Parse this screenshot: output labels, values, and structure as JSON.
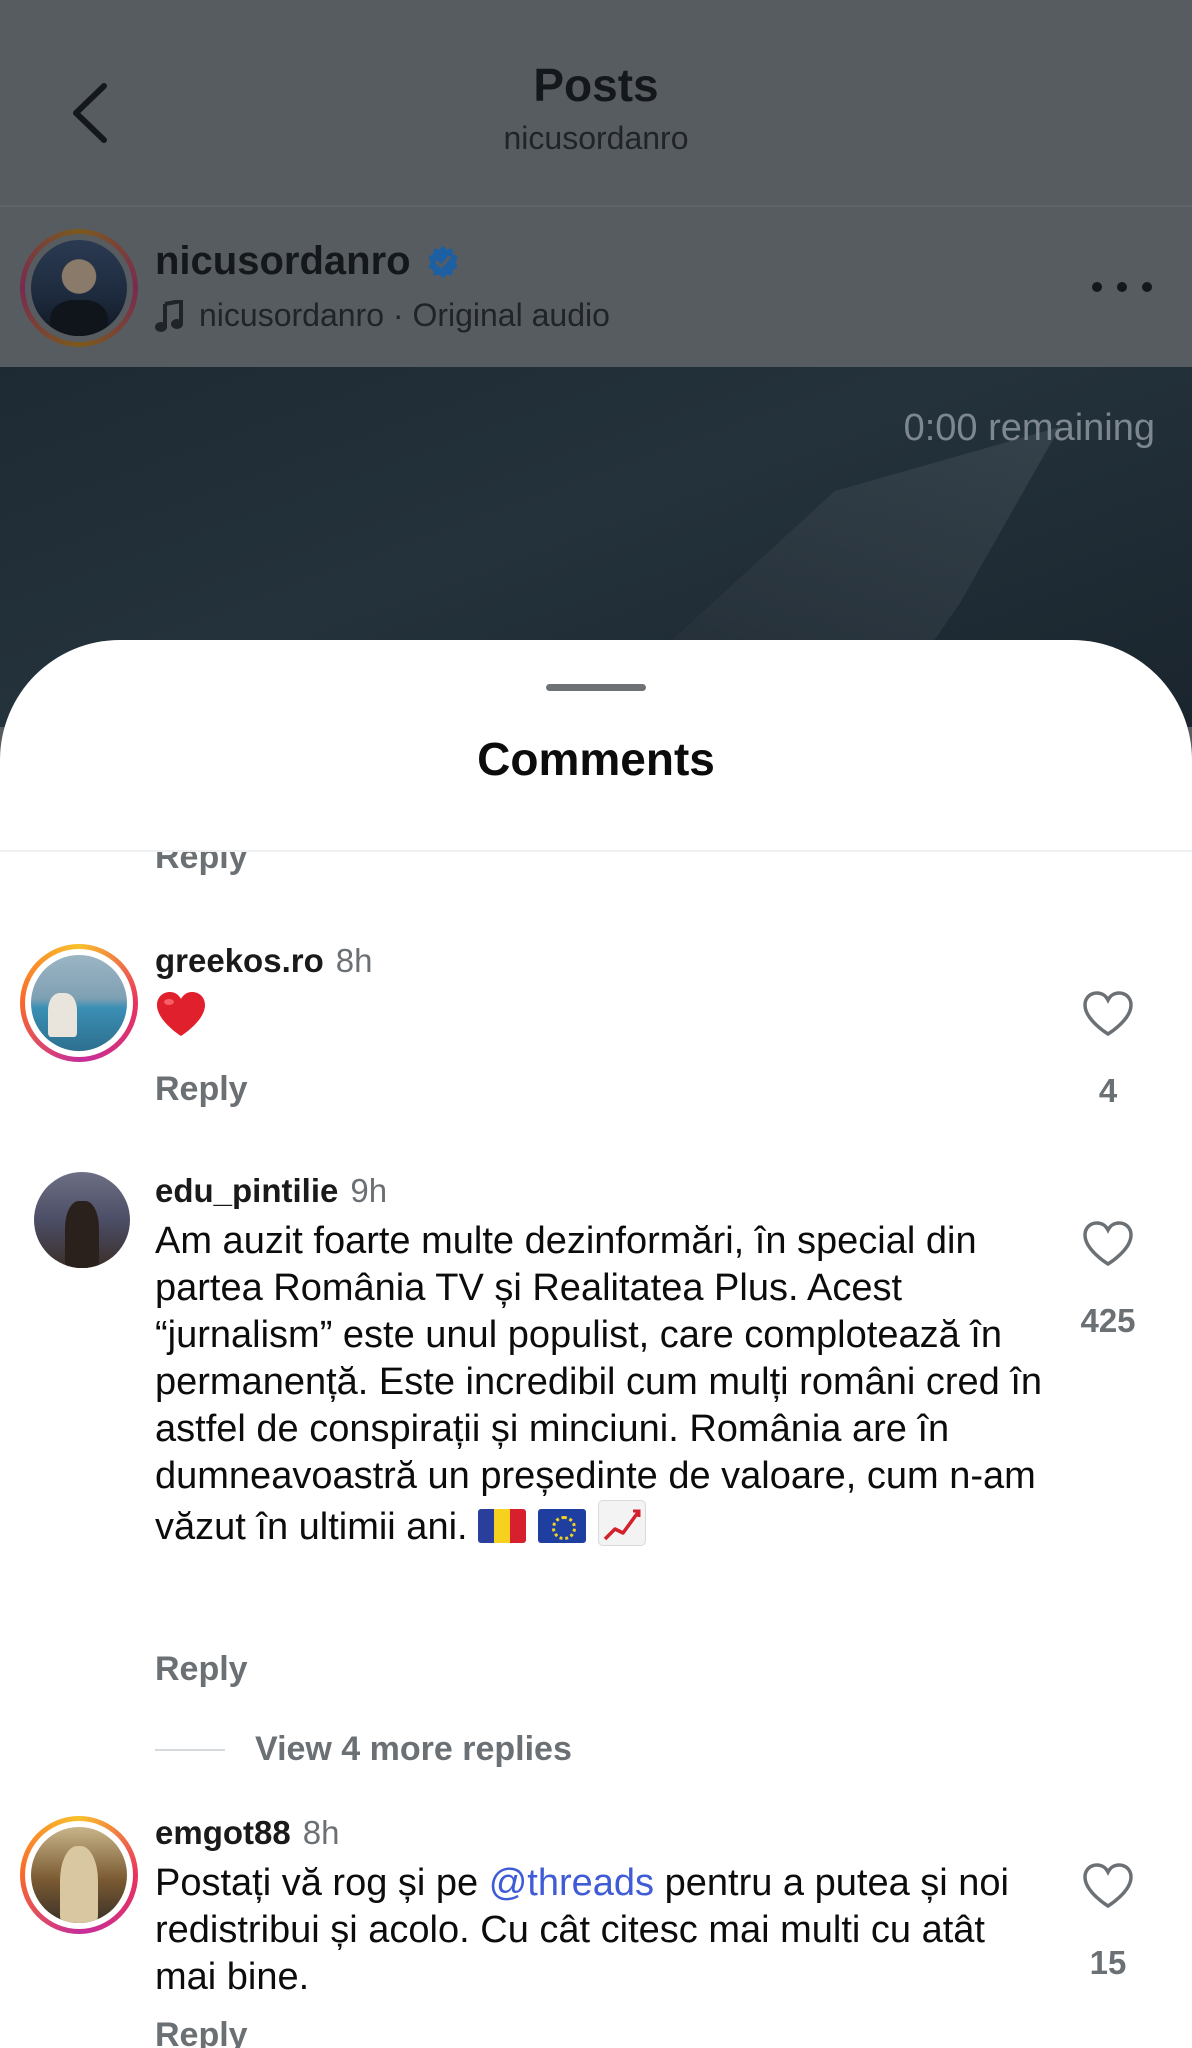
{
  "header": {
    "title": "Posts",
    "subtitle": "nicusordanro"
  },
  "post": {
    "author": "nicusordanro",
    "verified": true,
    "audio": "nicusordanro · Original audio",
    "remaining": "0:00 remaining"
  },
  "sheet": {
    "title": "Comments",
    "reply_label": "Reply"
  },
  "comments": [
    {
      "username": "greekos.ro",
      "time": "8h",
      "text": "❤️",
      "reply": "Reply",
      "likes": "4"
    },
    {
      "username": "edu_pintilie",
      "time": "9h",
      "text": "Am auzit foarte multe dezinformări, în special din partea România TV și Realitatea Plus. Acest “jurnalism” este unul populist, care complotează în permanență. Este incredibil cum mulți români cred în astfel de conspirații și minciuni. România are în dumneavoastră un președinte de valoare, cum n-am văzut în ultimii ani.",
      "emojis": [
        "flag-romania",
        "flag-eu",
        "chart-increasing"
      ],
      "reply": "Reply",
      "likes": "425",
      "view_more": "View 4 more replies"
    },
    {
      "username": "emgot88",
      "time": "8h",
      "text_before": "Postați vă rog și pe ",
      "mention": "@threads",
      "text_after": " pentru a putea și noi redistribui și acolo. Cu cât citesc mai multi cu atât mai bine.",
      "reply": "Reply",
      "likes": "15"
    }
  ],
  "colors": {
    "mention": "#3f5bd6",
    "verified": "#1d78d6",
    "heart": "#e0202c",
    "muted": "#6b7075"
  }
}
